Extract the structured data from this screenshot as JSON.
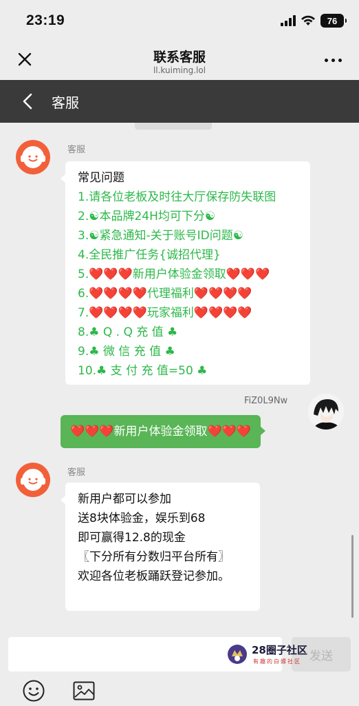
{
  "status_bar": {
    "time": "23:19",
    "battery": "76"
  },
  "web_header": {
    "title": "联系客服",
    "url": "ll.kuiming.lol"
  },
  "chat_header": {
    "title": "客服"
  },
  "messages": [
    {
      "sender": "客服",
      "lines": [
        "常见问题",
        "1.请各位老板及时往大厅保存防失联图",
        "2.☯本品牌24H均可下分☯",
        "3.☯紧急通知-关于账号ID问题☯",
        "4.全民推广任务{诚招代理}",
        "5.❤️❤️❤️新用户体验金领取❤️❤️❤️",
        "6.❤️❤️❤️❤️代理福利❤️❤️❤️❤️",
        "7.❤️❤️❤️❤️玩家福利❤️❤️❤️❤️",
        "8.♣ Q . Q 充 值 ♣",
        "9.♣ 微 信 充 值 ♣",
        "10.♣ 支 付 充 值=50 ♣"
      ]
    },
    {
      "sender": "FiZ0L9Nw",
      "text": "❤️❤️❤️新用户体验金领取❤️❤️❤️"
    },
    {
      "sender": "客服",
      "lines": [
        "新用户都可以参加",
        "送8块体验金，娱乐到68",
        "即可赢得12.8的现金",
        "〖下分所有分数归平台所有〗",
        "欢迎各位老板踊跃登记参加。"
      ]
    }
  ],
  "input": {
    "value": "",
    "send_label": "发送"
  },
  "watermark": {
    "title": "28圈子社区",
    "subtitle": "有趣的白嫖社区"
  },
  "colors": {
    "bubble_green": "#59b556",
    "link_green": "#2db84a",
    "header_dark": "#3a3a3a",
    "cs_orange": "#f2603a"
  }
}
